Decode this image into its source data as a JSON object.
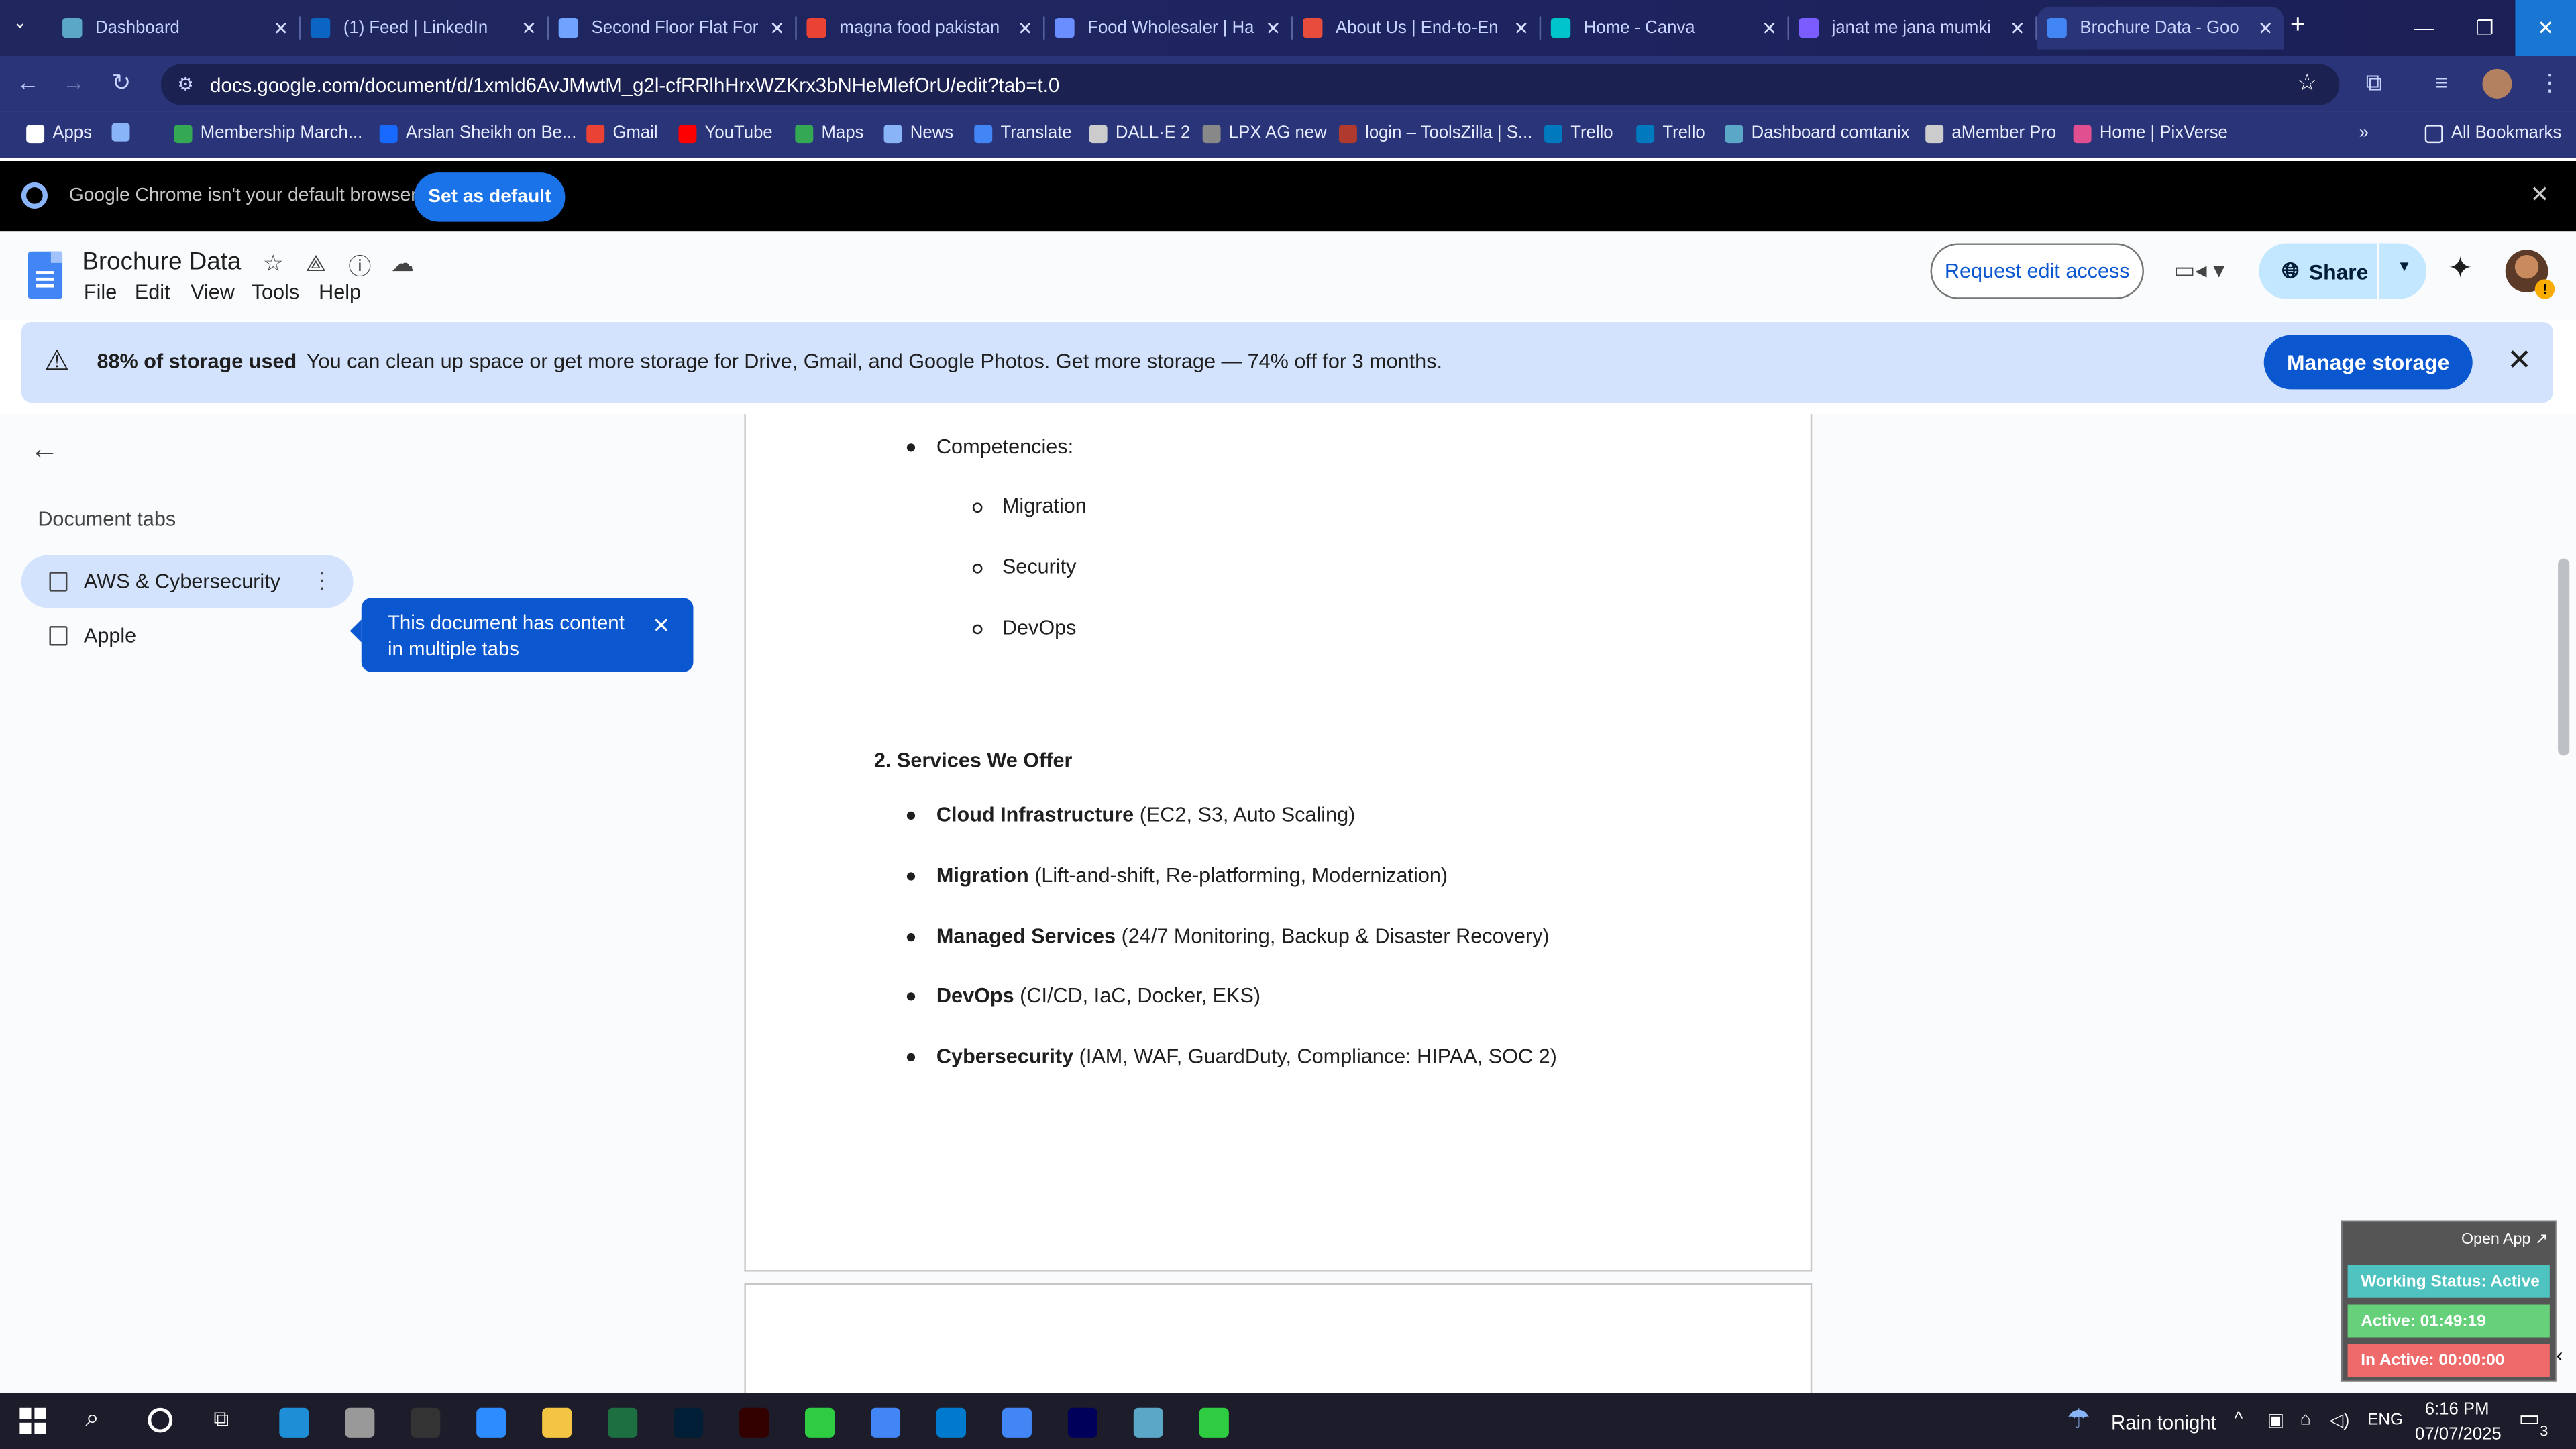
{
  "browser": {
    "tabs": [
      {
        "title": "Dashboard",
        "color": "#5aa7c8"
      },
      {
        "title": "(1) Feed | LinkedIn",
        "color": "#0a66c2"
      },
      {
        "title": "Second Floor Flat For",
        "color": "#6fa3ff"
      },
      {
        "title": "magna food pakistan",
        "color": "#ea4335"
      },
      {
        "title": "Food Wholesaler | Ha",
        "color": "#6a8dff"
      },
      {
        "title": "About Us | End-to-En",
        "color": "#e74c3c"
      },
      {
        "title": "Home - Canva",
        "color": "#00c4cc"
      },
      {
        "title": "janat me jana mumki",
        "color": "#7b5cff"
      },
      {
        "title": "Brochure Data - Goo",
        "color": "#4285f4"
      }
    ],
    "url": "docs.google.com/document/d/1xmld6AvJMwtM_g2l-cfRRlhHrxWZKrx3bNHeMlefOrU/edit?tab=t.0",
    "bookmarks": [
      {
        "label": "Apps",
        "color": "#ffffff"
      },
      {
        "label": "",
        "color": "#8ab4f8"
      },
      {
        "label": "Membership March...",
        "color": "#34a853"
      },
      {
        "label": "Arslan Sheikh on Be...",
        "color": "#1769ff"
      },
      {
        "label": "Gmail",
        "color": "#ea4335"
      },
      {
        "label": "YouTube",
        "color": "#ff0000"
      },
      {
        "label": "Maps",
        "color": "#34a853"
      },
      {
        "label": "News",
        "color": "#8ab4f8"
      },
      {
        "label": "Translate",
        "color": "#4285f4"
      },
      {
        "label": "DALL·E 2",
        "color": "#cccccc"
      },
      {
        "label": "LPX AG new",
        "color": "#888888"
      },
      {
        "label": "login – ToolsZilla | S...",
        "color": "#b03a2e"
      },
      {
        "label": "Trello",
        "color": "#0079bf"
      },
      {
        "label": "Trello",
        "color": "#0079bf"
      },
      {
        "label": "Dashboard comtanix",
        "color": "#5aa7c8"
      },
      {
        "label": "aMember Pro",
        "color": "#cccccc"
      },
      {
        "label": "Home | PixVerse",
        "color": "#e05090"
      }
    ],
    "all_bookmarks": "All Bookmarks",
    "default_msg": "Google Chrome isn't your default browser",
    "set_default": "Set as default"
  },
  "docs": {
    "title": "Brochure Data",
    "menus": [
      "File",
      "Edit",
      "View",
      "Tools",
      "Help"
    ],
    "request_edit": "Request edit access",
    "share": "Share",
    "storage_bold": "88% of storage used",
    "storage_text": "You can clean up space or get more storage for Drive, Gmail, and Google Photos. Get more storage — 74% off for 3 months.",
    "manage_storage": "Manage storage",
    "document_tabs": "Document tabs",
    "tabs": [
      "AWS & Cybersecurity",
      "Apple"
    ],
    "tooltip": "This document has content in multiple tabs"
  },
  "content": {
    "competencies": "Competencies:",
    "sub": [
      "Migration",
      "Security",
      "DevOps"
    ],
    "heading": "2. Services We Offer",
    "services": [
      {
        "bold": "Cloud Infrastructure",
        "rest": " (EC2, S3, Auto Scaling)"
      },
      {
        "bold": "Migration",
        "rest": " (Lift-and-shift, Re-platforming, Modernization)"
      },
      {
        "bold": "Managed Services",
        "rest": " (24/7 Monitoring, Backup & Disaster Recovery)"
      },
      {
        "bold": "DevOps",
        "rest": " (CI/CD, IaC, Docker, EKS)"
      },
      {
        "bold": "Cybersecurity",
        "rest": " (IAM, WAF, GuardDuty, Compliance: HIPAA, SOC 2)"
      }
    ]
  },
  "tracker": {
    "open_app": "Open App ↗",
    "working": "Working Status: Active",
    "active": "Active: 01:49:19",
    "inactive": "In Active: 00:00:00",
    "colors": {
      "working": "#4fc3c0",
      "active": "#66d17a",
      "inactive": "#ef6a6a"
    }
  },
  "taskbar": {
    "weather": "Rain tonight",
    "lang": "ENG",
    "time": "6:16 PM",
    "date": "07/07/2025",
    "notif": "3"
  }
}
